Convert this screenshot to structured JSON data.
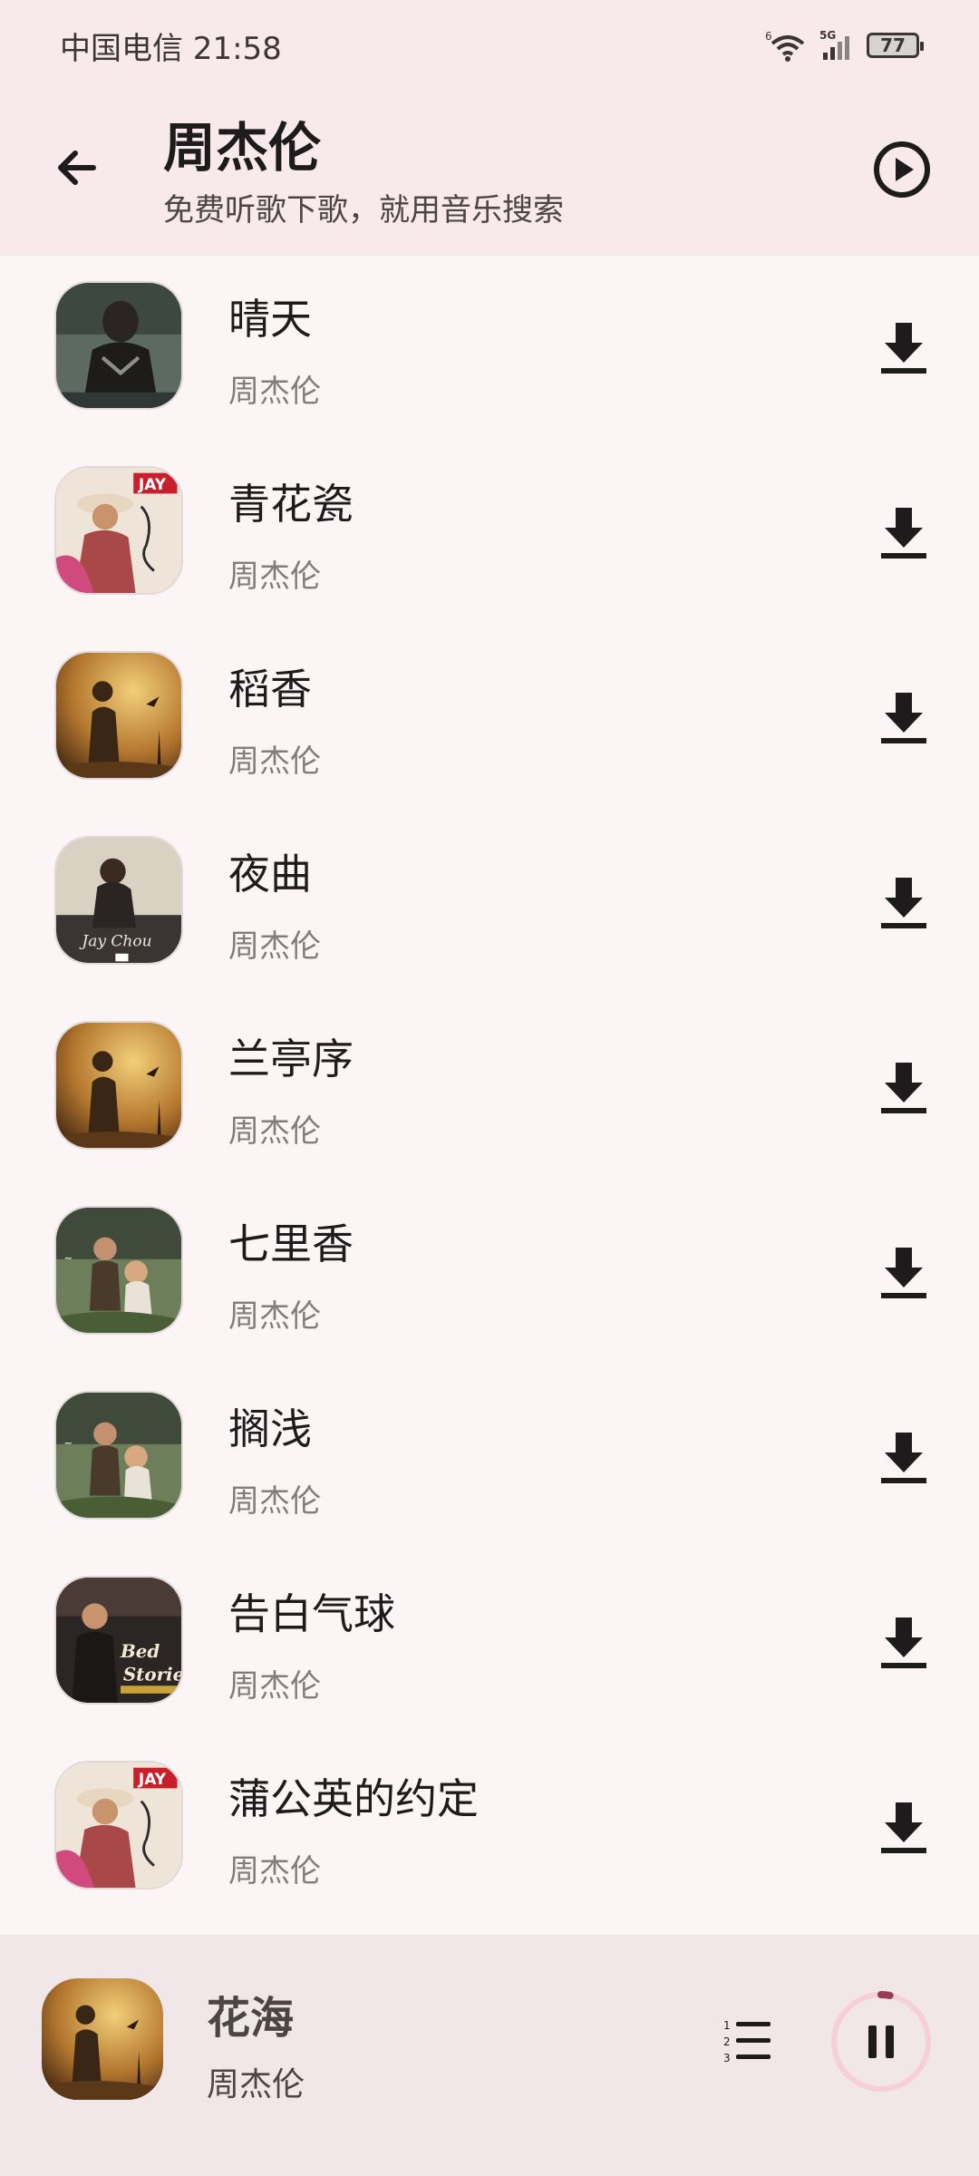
{
  "status_bar": {
    "carrier_time": "中国电信 21:58",
    "wifi_badge": "6",
    "network": "5G",
    "battery": "77"
  },
  "header": {
    "title": "周杰伦",
    "subtitle": "免费听歌下歌，就用音乐搜索"
  },
  "songs": [
    {
      "title": "晴天",
      "artist": "周杰伦",
      "cover": "dark-jacket-cover"
    },
    {
      "title": "青花瓷",
      "artist": "周杰伦",
      "cover": "jay-cowboy-cover"
    },
    {
      "title": "稻香",
      "artist": "周杰伦",
      "cover": "golden-field-cover"
    },
    {
      "title": "夜曲",
      "artist": "周杰伦",
      "cover": "jay-chou-night-cover"
    },
    {
      "title": "兰亭序",
      "artist": "周杰伦",
      "cover": "golden-field-cover"
    },
    {
      "title": "七里香",
      "artist": "周杰伦",
      "cover": "seven-mile-cover"
    },
    {
      "title": "搁浅",
      "artist": "周杰伦",
      "cover": "seven-mile-cover"
    },
    {
      "title": "告白气球",
      "artist": "周杰伦",
      "cover": "bedtime-stories-cover"
    },
    {
      "title": "蒲公英的约定",
      "artist": "周杰伦",
      "cover": "jay-cowboy-cover"
    }
  ],
  "now_playing": {
    "title": "花海",
    "artist": "周杰伦",
    "cover": "golden-field-cover",
    "progress": 0.03
  },
  "colors": {
    "header_bg": "#f8e9ec",
    "list_bg": "#fcf5f5",
    "player_bg": "#f1e6e8",
    "accent": "#9a3c56"
  },
  "icons": {
    "back": "arrow-left-icon",
    "play_all": "play-circle-icon",
    "download": "download-icon",
    "playlist": "numbered-list-icon",
    "pause": "pause-icon"
  }
}
